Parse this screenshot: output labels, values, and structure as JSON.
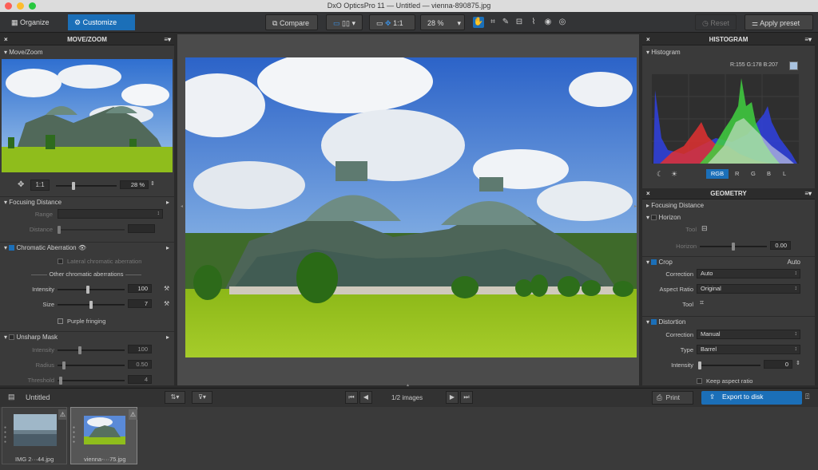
{
  "window": {
    "title": "DxO OpticsPro 11 — Untitled — vienna-890875.jpg"
  },
  "toolbar": {
    "organize": "Organize",
    "customize": "Customize",
    "compare": "Compare",
    "one_to_one": "1:1",
    "zoom": "28 %",
    "reset": "Reset",
    "apply_preset": "Apply preset"
  },
  "move_zoom": {
    "panel_title": "MOVE/ZOOM",
    "section": "Move/Zoom",
    "one_to_one": "1:1",
    "zoom": "28 %"
  },
  "focusing_left": {
    "title": "Focusing Distance",
    "range": "Range",
    "distance": "Distance"
  },
  "chromatic": {
    "title": "Chromatic Aberration",
    "lateral": "Lateral chromatic aberration",
    "other": "Other chromatic aberrations",
    "intensity_label": "Intensity",
    "intensity": "100",
    "size_label": "Size",
    "size": "7",
    "purple": "Purple fringing",
    "intensity_level": 0.45,
    "size_level": 0.5
  },
  "unsharp": {
    "title": "Unsharp Mask",
    "intensity_label": "Intensity",
    "intensity": "100",
    "radius_label": "Radius",
    "radius": "0.50",
    "threshold_label": "Threshold",
    "threshold": "4"
  },
  "histogram": {
    "panel_title": "HISTOGRAM",
    "section": "Histogram",
    "readout": "R:155 G:178 B:207",
    "channels": [
      "RGB",
      "R",
      "G",
      "B",
      "L"
    ],
    "swatch": "#a9c3e0"
  },
  "geometry": {
    "panel_title": "GEOMETRY",
    "focusing": "Focusing Distance",
    "horizon": "Horizon",
    "horizon_tool": "Tool",
    "horizon_label": "Horizon",
    "horizon_value": "0.00",
    "crop": "Crop",
    "crop_auto": "Auto",
    "correction_label": "Correction",
    "crop_correction": "Auto",
    "aspect_label": "Aspect Ratio",
    "aspect": "Original",
    "tool_label": "Tool",
    "distortion": "Distortion",
    "dist_correction": "Manual",
    "type_label": "Type",
    "type": "Barrel",
    "intensity_label": "Intensity",
    "intensity": "0",
    "keep_aspect": "Keep aspect ratio"
  },
  "bottom": {
    "project": "Untitled",
    "images": "1/2 images",
    "print": "Print",
    "export": "Export to disk"
  },
  "filmstrip": {
    "items": [
      {
        "name": "IMG 2···44.jpg"
      },
      {
        "name": "vienna-···75.jpg"
      }
    ]
  },
  "colors": {
    "accent": "#1b6fb8",
    "highlight": "#2a7ac8"
  }
}
